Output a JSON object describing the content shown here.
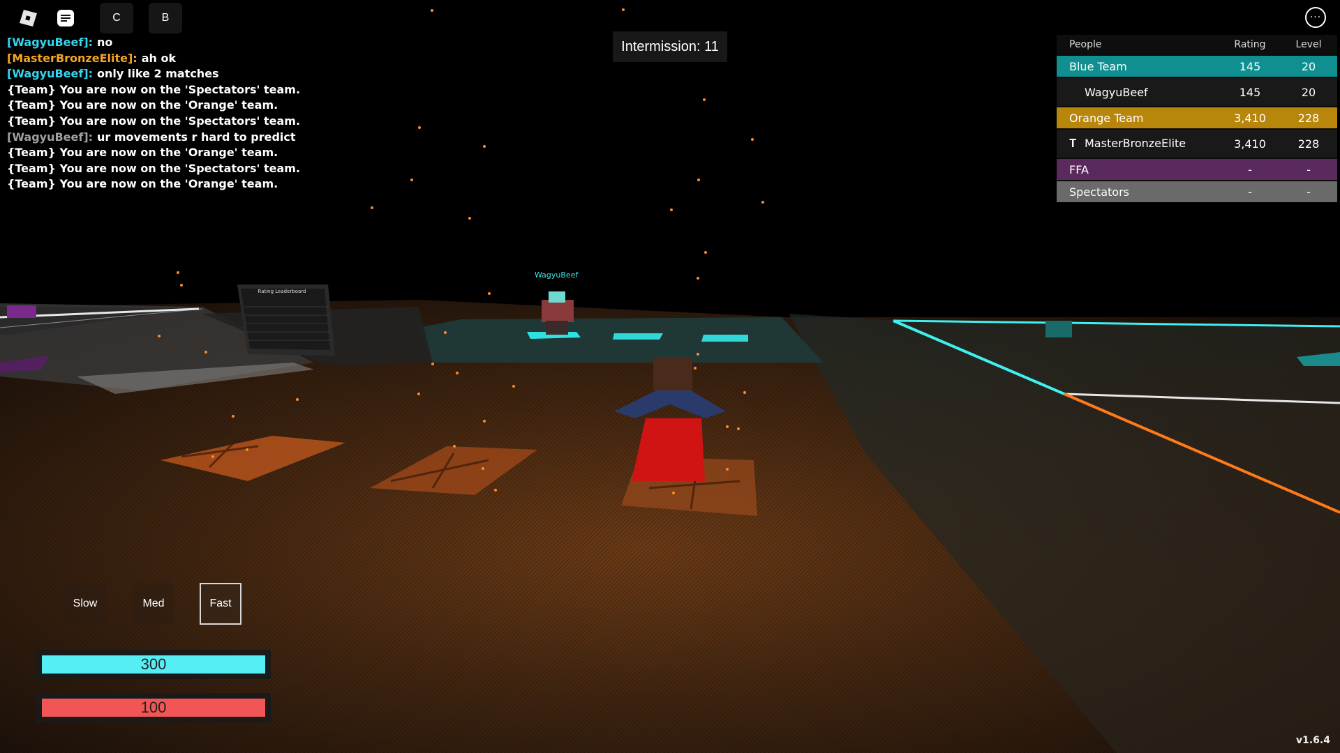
{
  "top_buttons": {
    "chat_label": "C",
    "backpack_label": "B"
  },
  "chat": [
    {
      "who": "[WagyuBeef]:",
      "who_color": "#33d6f0",
      "text": "no"
    },
    {
      "who": "[MasterBronzeElite]:",
      "who_color": "#f5a623",
      "text": "ah ok"
    },
    {
      "who": "[WagyuBeef]:",
      "who_color": "#33d6f0",
      "text": "only like 2 matches"
    },
    {
      "who": "",
      "who_color": "#ffffff",
      "text": "{Team} You are now on the 'Spectators' team."
    },
    {
      "who": "",
      "who_color": "#ffffff",
      "text": "{Team} You are now on the 'Orange' team."
    },
    {
      "who": "",
      "who_color": "#ffffff",
      "text": "{Team} You are now on the 'Spectators' team."
    },
    {
      "who": "[WagyuBeef]:",
      "who_color": "#a0a0a0",
      "text": "ur movements r hard to predict"
    },
    {
      "who": "",
      "who_color": "#ffffff",
      "text": "{Team} You are now on the 'Orange' team."
    },
    {
      "who": "",
      "who_color": "#ffffff",
      "text": "{Team} You are now on the 'Spectators' team."
    },
    {
      "who": "",
      "who_color": "#ffffff",
      "text": "{Team} You are now on the 'Orange' team."
    }
  ],
  "intermission": "Intermission: 11",
  "leaderboard": {
    "headers": {
      "name": "People",
      "rating": "Rating",
      "level": "Level"
    },
    "blue_team": {
      "name": "Blue Team",
      "rating": "145",
      "level": "20",
      "color": "#0f8f8f"
    },
    "blue_player": {
      "name": "WagyuBeef",
      "rating": "145",
      "level": "20"
    },
    "orange_team": {
      "name": "Orange Team",
      "rating": "3,410",
      "level": "228",
      "color": "#b8860b"
    },
    "orange_player": {
      "name": "MasterBronzeElite",
      "rating": "3,410",
      "level": "228"
    },
    "ffa": {
      "name": "FFA",
      "rating": "-",
      "level": "-",
      "color": "#5a2a5e"
    },
    "spectators": {
      "name": "Spectators",
      "rating": "-",
      "level": "-",
      "color": "#6a6a6a"
    }
  },
  "world": {
    "player_tag": "WagyuBeef",
    "board_title": "Rating Leaderboard"
  },
  "speed": {
    "slow": "Slow",
    "med": "Med",
    "fast": "Fast",
    "selected": "Fast"
  },
  "bars": {
    "top": {
      "value": "300",
      "color": "#55eef5"
    },
    "bottom": {
      "value": "100",
      "color": "#f25555"
    }
  },
  "version": "v1.6.4"
}
